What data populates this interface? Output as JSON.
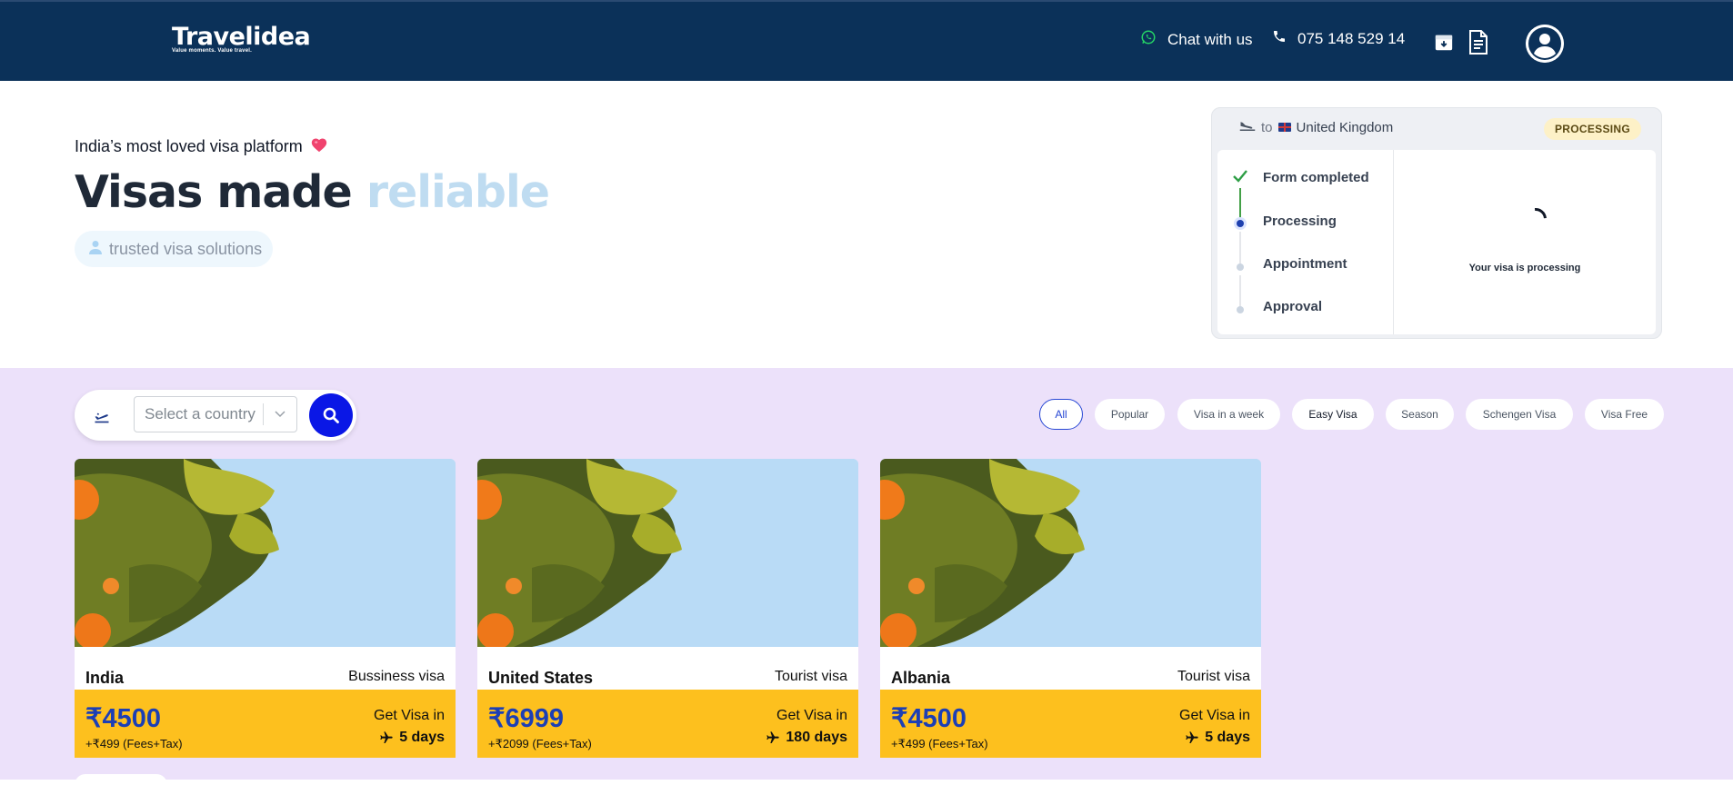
{
  "header": {
    "logo": {
      "wordmark": "Travelidea",
      "tagline": "Value moments. Value travel."
    },
    "chat_label": "Chat with us",
    "phone": "075 148 529 14",
    "icons": [
      "whatsapp-icon",
      "phone-icon",
      "archive-icon",
      "document-icon",
      "user-avatar-icon"
    ],
    "colors": {
      "bar": "#0b3159",
      "whatsapp": "#25d366"
    }
  },
  "hero": {
    "kicker": "India’s most loved visa platform",
    "title_main": "Visas made",
    "title_accent": "reliable",
    "trust_pill": "trusted visa solutions"
  },
  "status_card": {
    "to_label": "to",
    "destination": "United Kingdom",
    "badge": "PROCESSING",
    "steps": [
      {
        "label": "Form completed",
        "state": "done"
      },
      {
        "label": "Processing",
        "state": "current"
      },
      {
        "label": "Appointment",
        "state": "pending"
      },
      {
        "label": "Approval",
        "state": "pending"
      }
    ],
    "message": "Your visa is processing"
  },
  "search": {
    "placeholder": "Select a country"
  },
  "filters": [
    {
      "label": "All",
      "active": true
    },
    {
      "label": "Popular",
      "active": false
    },
    {
      "label": "Visa in a week",
      "active": false
    },
    {
      "label": "Easy Visa",
      "active": false
    },
    {
      "label": "Season",
      "active": false
    },
    {
      "label": "Schengen Visa",
      "active": false
    },
    {
      "label": "Visa Free",
      "active": false
    }
  ],
  "cards": [
    {
      "country": "India",
      "visa_type": "Bussiness visa",
      "price": "₹4500",
      "fees": "+₹499 (Fees+Tax)",
      "get_visa_label": "Get Visa in",
      "days": "5 days"
    },
    {
      "country": "United States",
      "visa_type": "Tourist visa",
      "price": "₹6999",
      "fees": "+₹2099 (Fees+Tax)",
      "get_visa_label": "Get Visa in",
      "days": "180 days"
    },
    {
      "country": "Albania",
      "visa_type": "Tourist visa",
      "price": "₹4500",
      "fees": "+₹499 (Fees+Tax)",
      "get_visa_label": "Get Visa in",
      "days": "5 days"
    }
  ],
  "accent_colors": {
    "price_bar": "#fdc01e",
    "price_text": "#1c3fb5",
    "search_button": "#0a17e6",
    "section_bg": "#ece1fa"
  }
}
